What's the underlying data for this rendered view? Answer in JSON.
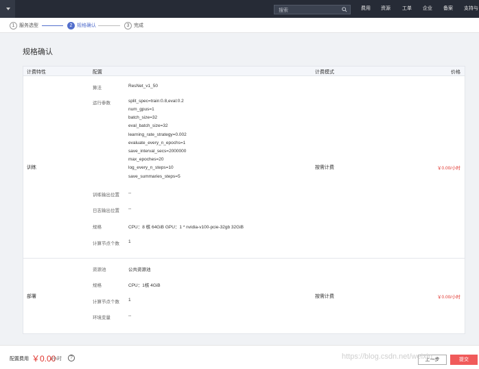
{
  "topbar": {
    "search_placeholder": "搜索",
    "nav": [
      "费用",
      "资源",
      "工单",
      "企业",
      "备案",
      "支持与"
    ]
  },
  "steps": [
    {
      "num": "1",
      "label": "服务选型"
    },
    {
      "num": "2",
      "label": "规格确认"
    },
    {
      "num": "3",
      "label": "完成"
    }
  ],
  "page": {
    "title": "规格确认"
  },
  "table": {
    "headers": {
      "feature": "计费特性",
      "config": "配置",
      "mode": "计费模式",
      "price": "价格"
    },
    "train": {
      "feature": "训练",
      "mode": "按需计费",
      "price": "￥0.00/小时",
      "algo_key": "算法",
      "algo_val": "ResNet_v1_50",
      "params_key": "运行参数",
      "params": [
        "split_spec=train:0.8,eval:0.2",
        "num_gpus=1",
        "batch_size=32",
        "eval_batch_size=32",
        "learning_rate_strategy=0.002",
        "evaluate_every_n_epochs=1",
        "save_interval_secs=2000000",
        "max_epoches=20",
        "log_every_n_steps=10",
        "save_summaries_steps=5"
      ],
      "output_key": "训练输出位置",
      "output_val": "--",
      "log_key": "日志输出位置",
      "log_val": "--",
      "spec_key": "规格",
      "spec_val": "CPU：8 核 64GiB GPU：1 * nvidia-v100-pcie-32gb 32GiB",
      "nodes_key": "计算节点个数",
      "nodes_val": "1"
    },
    "deploy": {
      "feature": "部署",
      "mode": "按需计费",
      "price": "￥0.00/小时",
      "pool_key": "资源池",
      "pool_val": "公共资源池",
      "spec_key": "规格",
      "spec_val": "CPU：1核 4GiB",
      "nodes_key": "计算节点个数",
      "nodes_val": "1",
      "env_key": "环境变量",
      "env_val": "--"
    }
  },
  "footer": {
    "fee_label": "配置费用",
    "fee_amount": "￥0.00",
    "fee_unit": "/小时",
    "help": "?",
    "prev_button": "上一步",
    "submit_button": "提交"
  },
  "watermark": "https://blog.csdn.net/weixin_"
}
